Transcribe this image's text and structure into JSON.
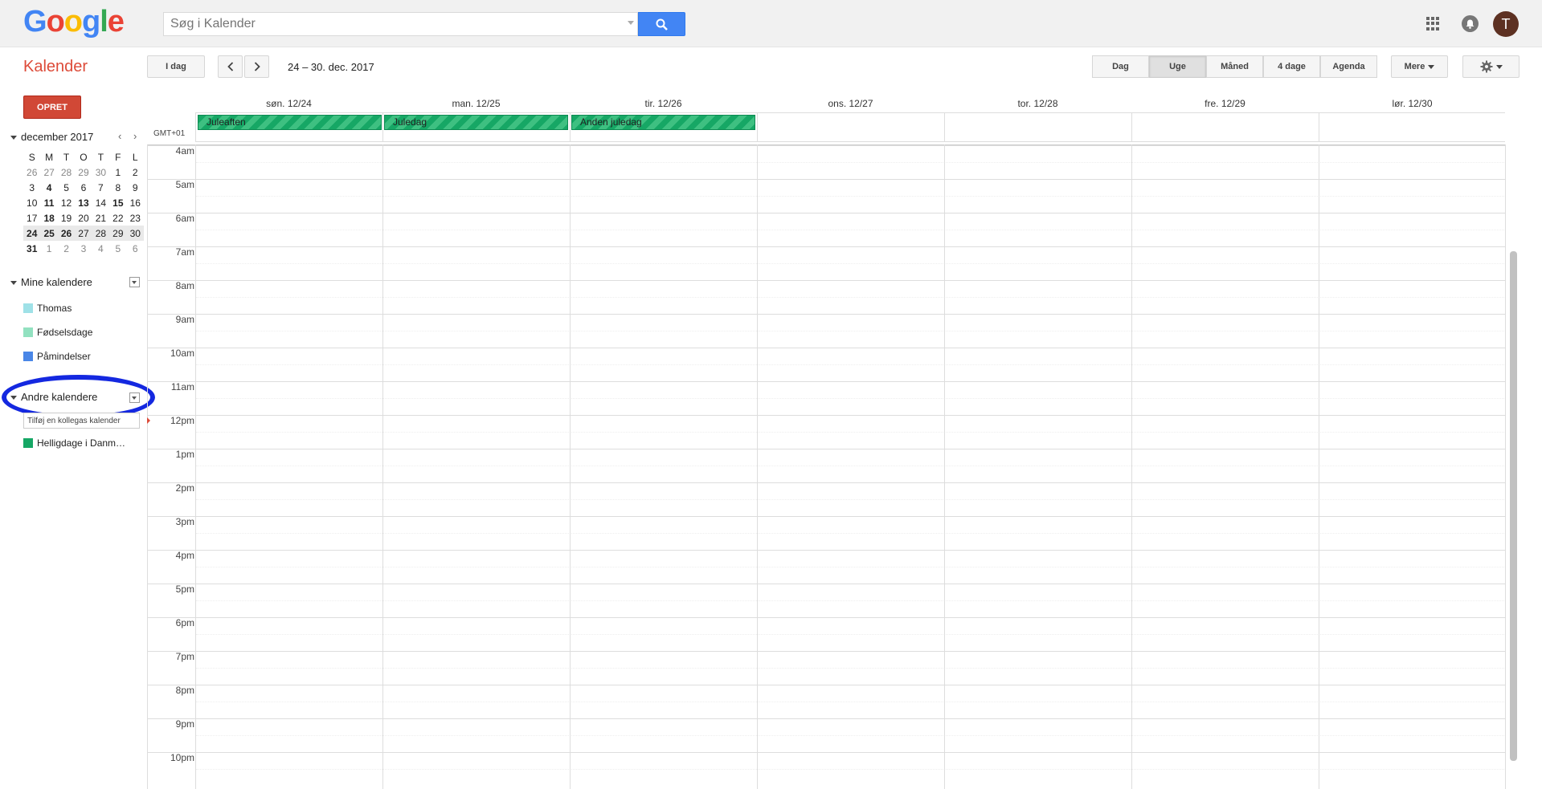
{
  "header": {
    "logo_letters": [
      "G",
      "o",
      "o",
      "g",
      "l",
      "e"
    ],
    "search_placeholder": "Søg i Kalender",
    "avatar_letter": "T"
  },
  "toolbar": {
    "app_title": "Kalender",
    "today_label": "I dag",
    "date_range": "24 – 30. dec. 2017",
    "views": [
      "Dag",
      "Uge",
      "Måned",
      "4 dage",
      "Agenda"
    ],
    "active_view": "Uge",
    "more_label": "Mere"
  },
  "sidebar": {
    "create_label": "OPRET",
    "mini_month": "december 2017",
    "weekday_headers": [
      "S",
      "M",
      "T",
      "O",
      "T",
      "F",
      "L"
    ],
    "weeks": [
      [
        "26",
        "27",
        "28",
        "29",
        "30",
        "1",
        "2"
      ],
      [
        "3",
        "4",
        "5",
        "6",
        "7",
        "8",
        "9"
      ],
      [
        "10",
        "11",
        "12",
        "13",
        "14",
        "15",
        "16"
      ],
      [
        "17",
        "18",
        "19",
        "20",
        "21",
        "22",
        "23"
      ],
      [
        "24",
        "25",
        "26",
        "27",
        "28",
        "29",
        "30"
      ],
      [
        "31",
        "1",
        "2",
        "3",
        "4",
        "5",
        "6"
      ]
    ],
    "my_calendars_label": "Mine kalendere",
    "my_calendars": [
      {
        "name": "Thomas",
        "color": "#9fe1e7"
      },
      {
        "name": "Fødselsdage",
        "color": "#92e1c0"
      },
      {
        "name": "Påmindelser",
        "color": "#4986e7"
      }
    ],
    "other_calendars_label": "Andre kalendere",
    "add_colleague_placeholder": "Tilføj en kollegas kalender",
    "other_calendars": [
      {
        "name": "Helligdage i Danm…",
        "color": "#16a765"
      }
    ]
  },
  "calendar": {
    "timezone": "GMT+01",
    "days": [
      "søn. 12/24",
      "man. 12/25",
      "tir. 12/26",
      "ons. 12/27",
      "tor. 12/28",
      "fre. 12/29",
      "lør. 12/30"
    ],
    "allday_events": [
      {
        "day": 0,
        "title": "Juleaften"
      },
      {
        "day": 1,
        "title": "Juledag"
      },
      {
        "day": 2,
        "title": "Anden juledag"
      }
    ],
    "hours": [
      "4am",
      "5am",
      "6am",
      "7am",
      "8am",
      "9am",
      "10am",
      "11am",
      "12pm",
      "1pm",
      "2pm",
      "3pm",
      "4pm",
      "5pm",
      "6pm",
      "7pm",
      "8pm",
      "9pm",
      "10pm"
    ],
    "event_color": "#16a765"
  }
}
